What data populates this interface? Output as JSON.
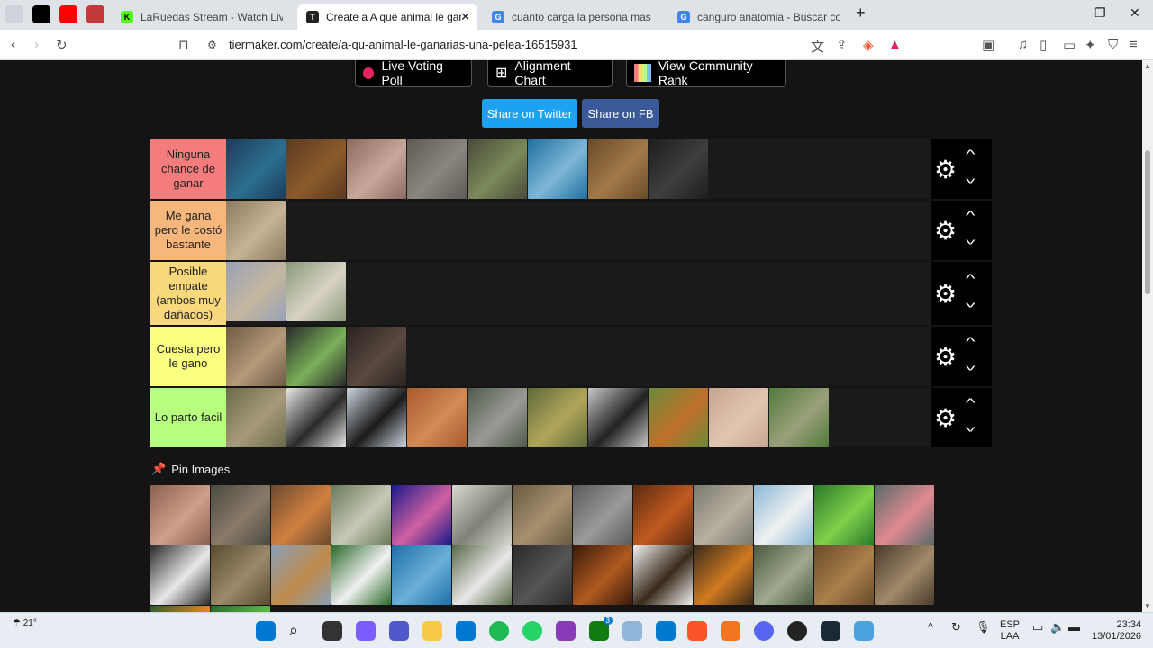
{
  "browser": {
    "tabs": [
      {
        "title": "LaRuedas Stream - Watch Live on Kic",
        "favicon_color": "#53fc18",
        "favicon_letter": "K"
      },
      {
        "title": "Create a A qué animal le ganaria",
        "favicon_color": "#222222",
        "favicon_letter": "T"
      },
      {
        "title": "cuanto carga la persona mas fuerte d",
        "favicon_color": "#4285f4",
        "favicon_letter": "G"
      },
      {
        "title": "canguro anatomia - Buscar con Goog",
        "favicon_color": "#4285f4",
        "favicon_letter": "G"
      }
    ],
    "url": "tiermaker.com/create/a-qu-animal-le-ganarias-una-pelea-16515931",
    "new_tab_label": "+",
    "brave_badge": "5"
  },
  "page": {
    "buttons": {
      "live_voting": "Live Voting Poll",
      "alignment_chart": "Alignment Chart",
      "community_rank": "View Community Rank",
      "share_twitter": "Share on Twitter",
      "share_fb": "Share on FB"
    },
    "tiers": [
      {
        "label": "Ninguna chance de ganar",
        "color": "#f47c7c",
        "items": [
          "whale",
          "bear",
          "walrus",
          "elephant",
          "buffalo",
          "shark",
          "deer",
          "gorilla"
        ]
      },
      {
        "label": "Me gana pero le costó bastante",
        "color": "#f7b77c",
        "items": [
          "kangaroo"
        ]
      },
      {
        "label": "Posible empate (ambos muy dañados)",
        "color": "#f7d87c",
        "items": [
          "ostrich",
          "emu"
        ]
      },
      {
        "label": "Cuesta pero le gano",
        "color": "#fbff7f",
        "items": [
          "python",
          "cow",
          "komodo"
        ]
      },
      {
        "label": "Lo parto facil",
        "color": "#b9ff7f",
        "items": [
          "sloth",
          "scorpion",
          "penguin",
          "meerkat",
          "koala-grey",
          "chameleon",
          "crow",
          "squirrel",
          "armadillo",
          "tortoise"
        ]
      }
    ],
    "pin_title": "Pin Images",
    "pool": [
      "pitbull",
      "hippo",
      "fox",
      "anteater",
      "octopus",
      "koala",
      "hyena",
      "rhino",
      "orangutan",
      "seal",
      "polar-bear",
      "parrot",
      "flamingo",
      "zebra",
      "owl",
      "giraffe",
      "panda",
      "dolphin",
      "rabbit",
      "wolf",
      "horse",
      "eagle",
      "tiger",
      "crocodile",
      "lion",
      "porcupine",
      "toucan",
      "frog"
    ]
  },
  "taskbar": {
    "weather": "21°",
    "lang_top": "ESP",
    "lang_bottom": "LAA",
    "time": "23:34",
    "date": "13/01/2026",
    "store_badge": "3"
  },
  "image_colors": {
    "whale": [
      "#1c3c5a",
      "#2d6f8f"
    ],
    "bear": [
      "#5a3a20",
      "#8b5a2b"
    ],
    "walrus": [
      "#8a6a60",
      "#c9a79a"
    ],
    "elephant": [
      "#5f5a55",
      "#8a857e"
    ],
    "buffalo": [
      "#4a4a3a",
      "#7a8a5a"
    ],
    "shark": [
      "#1f6f9f",
      "#7fb7d7"
    ],
    "deer": [
      "#6a4a2a",
      "#a27a4a"
    ],
    "gorilla": [
      "#1d1d1d",
      "#3f3f3f"
    ],
    "kangaroo": [
      "#8a7a60",
      "#c7b495"
    ],
    "ostrich": [
      "#9aa0b8",
      "#c4b7a0"
    ],
    "emu": [
      "#8a9a7a",
      "#d8d2c5"
    ],
    "python": [
      "#6f5a45",
      "#b49a7a"
    ],
    "cow": [
      "#2a2a2a",
      "#7ab05a"
    ],
    "komodo": [
      "#2a2220",
      "#5a4a40"
    ],
    "sloth": [
      "#6a6a4a",
      "#a69a7a"
    ],
    "scorpion": [
      "#e8e8e8",
      "#2a2a2a"
    ],
    "penguin": [
      "#cfd6e0",
      "#1a1a1a"
    ],
    "meerkat": [
      "#a85a30",
      "#d38a55"
    ],
    "koala-grey": [
      "#4f5a4a",
      "#9a9a95"
    ],
    "chameleon": [
      "#5f6a3a",
      "#b0a55a"
    ],
    "crow": [
      "#c8c8c8",
      "#222222"
    ],
    "squirrel": [
      "#6a8a3a",
      "#c0702a"
    ],
    "armadillo": [
      "#c7a590",
      "#e2c6b2"
    ],
    "tortoise": [
      "#4f7a3a",
      "#9aa07a"
    ],
    "pitbull": [
      "#8a6050",
      "#cfa08a"
    ],
    "hippo": [
      "#4a4a40",
      "#8a7a6a"
    ],
    "fox": [
      "#6a4a30",
      "#d08040"
    ],
    "anteater": [
      "#6a7a5a",
      "#c8c8b8"
    ],
    "octopus": [
      "#1a1a8a",
      "#d060a0"
    ],
    "koala": [
      "#d8d8d0",
      "#808078"
    ],
    "hyena": [
      "#6a5a40",
      "#a69070"
    ],
    "rhino": [
      "#5a5a5a",
      "#9a9a9a"
    ],
    "orangutan": [
      "#5a2a10",
      "#c05a20"
    ],
    "seal": [
      "#7a7a70",
      "#b8b0a0"
    ],
    "polar-bear": [
      "#8ab8d8",
      "#f0f0f0"
    ],
    "parrot": [
      "#2a7a2a",
      "#7fd04a"
    ],
    "flamingo": [
      "#5a6a6a",
      "#e08a90"
    ],
    "zebra": [
      "#2a2a2a",
      "#e8e8e8"
    ],
    "owl": [
      "#5a4a30",
      "#9a8a6a"
    ],
    "giraffe": [
      "#8aa0b8",
      "#c08a4a"
    ],
    "panda": [
      "#2a6a2a",
      "#f0f0f0"
    ],
    "dolphin": [
      "#1f6fa8",
      "#6ab0d8"
    ],
    "rabbit": [
      "#5a6a4a",
      "#e8e8e8"
    ],
    "wolf": [
      "#2a2a2a",
      "#555555"
    ],
    "horse": [
      "#3a1a0a",
      "#b05a20"
    ],
    "eagle": [
      "#f0f0f0",
      "#3a2a1a"
    ],
    "tiger": [
      "#3a2a1a",
      "#d07a20"
    ],
    "crocodile": [
      "#4a5a40",
      "#a0a890"
    ],
    "lion": [
      "#6a4a2a",
      "#a8804a"
    ],
    "porcupine": [
      "#4a3a2a",
      "#a08a6a"
    ],
    "toucan": [
      "#2a5a2a",
      "#f08a20"
    ],
    "frog": [
      "#2a6a2a",
      "#5ac04a"
    ]
  }
}
